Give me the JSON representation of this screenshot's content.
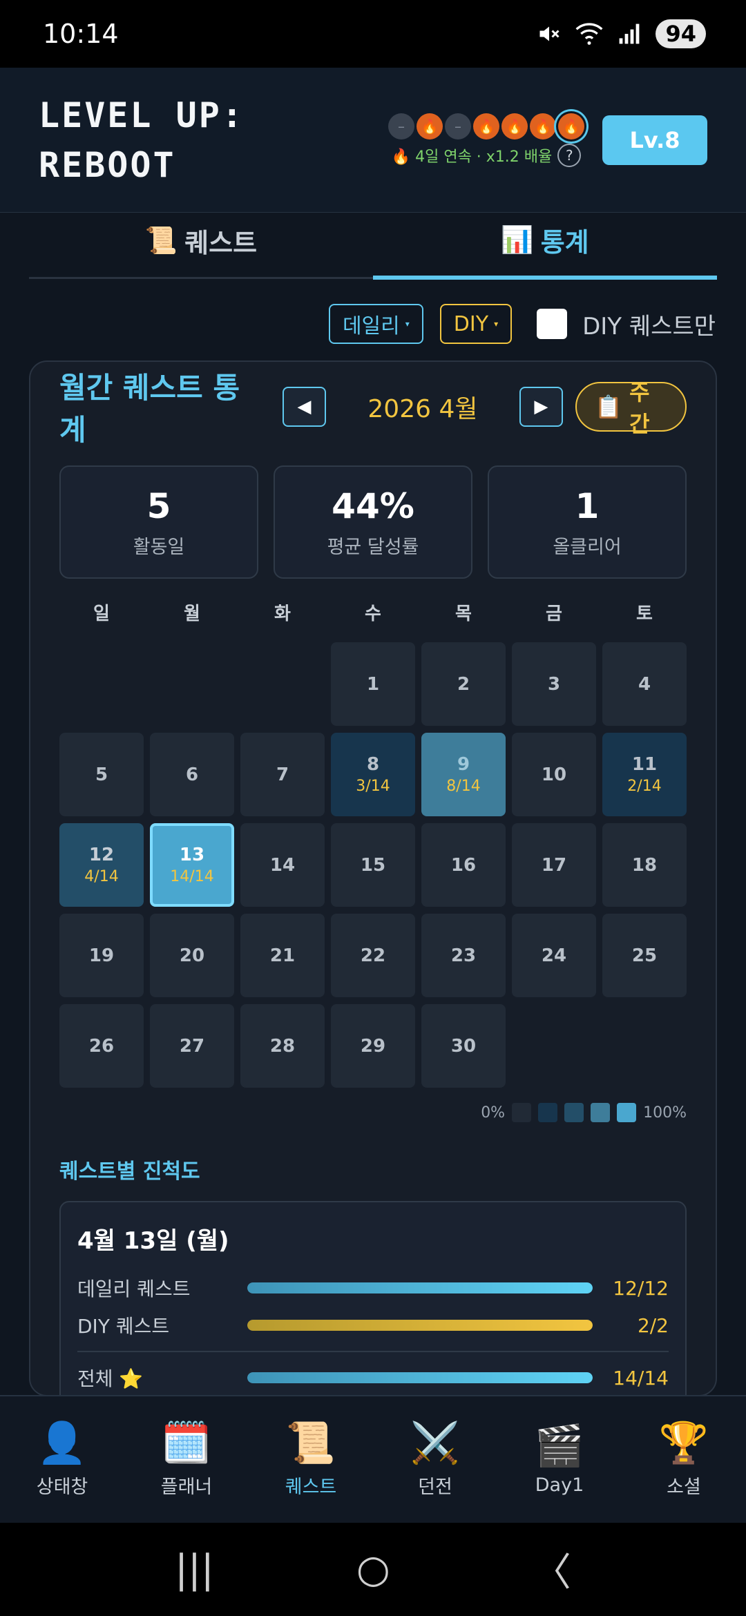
{
  "status_bar": {
    "time": "10:14",
    "battery": "94"
  },
  "header": {
    "title_line1": "LEVEL UP:",
    "title_line2": "REBOOT",
    "streak_text": "🔥 4일 연속 · x1.2 배율",
    "help": "?",
    "level": "Lv.8"
  },
  "streak_dots": [
    {
      "state": "off",
      "glyph": "–"
    },
    {
      "state": "on",
      "glyph": "🔥"
    },
    {
      "state": "off",
      "glyph": "–"
    },
    {
      "state": "on",
      "glyph": "🔥"
    },
    {
      "state": "on",
      "glyph": "🔥"
    },
    {
      "state": "on",
      "glyph": "🔥"
    },
    {
      "state": "today",
      "glyph": "🔥"
    }
  ],
  "tabs": [
    {
      "icon": "📜",
      "label": "퀘스트",
      "active": false
    },
    {
      "icon": "📊",
      "label": "통계",
      "active": true
    }
  ],
  "filters": {
    "daily": "데일리",
    "diy": "DIY",
    "caret": "▾",
    "diy_only": "DIY 퀘스트만"
  },
  "card": {
    "title": "월간 퀘스트 통계",
    "prev": "◀",
    "next": "▶",
    "month": "2026 4월",
    "weekly_icon": "📋",
    "weekly_label": "주간"
  },
  "stats": [
    {
      "value": "5",
      "label": "활동일"
    },
    {
      "value": "44%",
      "label": "평균 달성률"
    },
    {
      "value": "1",
      "label": "올클리어"
    }
  ],
  "weekdays": [
    "일",
    "월",
    "화",
    "수",
    "목",
    "금",
    "토"
  ],
  "calendar": {
    "leading_blanks": 3,
    "days": [
      {
        "d": "1"
      },
      {
        "d": "2"
      },
      {
        "d": "3"
      },
      {
        "d": "4"
      },
      {
        "d": "5"
      },
      {
        "d": "6"
      },
      {
        "d": "7"
      },
      {
        "d": "8",
        "p": "3/14",
        "level": 1
      },
      {
        "d": "9",
        "p": "8/14",
        "level": 3
      },
      {
        "d": "10"
      },
      {
        "d": "11",
        "p": "2/14",
        "level": 1
      },
      {
        "d": "12",
        "p": "4/14",
        "level": 2
      },
      {
        "d": "13",
        "p": "14/14",
        "level": 4,
        "today": true
      },
      {
        "d": "14"
      },
      {
        "d": "15"
      },
      {
        "d": "16"
      },
      {
        "d": "17"
      },
      {
        "d": "18"
      },
      {
        "d": "19"
      },
      {
        "d": "20"
      },
      {
        "d": "21"
      },
      {
        "d": "22"
      },
      {
        "d": "23"
      },
      {
        "d": "24"
      },
      {
        "d": "25"
      },
      {
        "d": "26"
      },
      {
        "d": "27"
      },
      {
        "d": "28"
      },
      {
        "d": "29"
      },
      {
        "d": "30"
      }
    ]
  },
  "legend": {
    "min": "0%",
    "max": "100%",
    "colors": [
      "#212a36",
      "#17354d",
      "#234e68",
      "#3e7d9a",
      "#4aa7cf"
    ]
  },
  "progress": {
    "section_title": "퀘스트별 진척도",
    "date": "4월 13일 (월)",
    "rows": [
      {
        "label": "데일리 퀘스트",
        "value": "12/12",
        "fraction": 1.0,
        "color": "blue"
      },
      {
        "label": "DIY 퀘스트",
        "value": "2/2",
        "fraction": 1.0,
        "color": "gold"
      }
    ],
    "total": {
      "label": "전체 ⭐",
      "value": "14/14",
      "fraction": 1.0,
      "color": "blue"
    }
  },
  "bottom_nav": [
    {
      "icon": "👤",
      "label": "상태창",
      "active": false
    },
    {
      "icon": "🗓️",
      "label": "플래너",
      "active": false
    },
    {
      "icon": "📜",
      "label": "퀘스트",
      "active": true
    },
    {
      "icon": "⚔️",
      "label": "던전",
      "active": false
    },
    {
      "icon": "🎬",
      "label": "Day1",
      "active": false
    },
    {
      "icon": "🏆",
      "label": "소셜",
      "active": false
    }
  ],
  "system_nav": {
    "recents": "|||",
    "home": "○",
    "back": "〈"
  }
}
